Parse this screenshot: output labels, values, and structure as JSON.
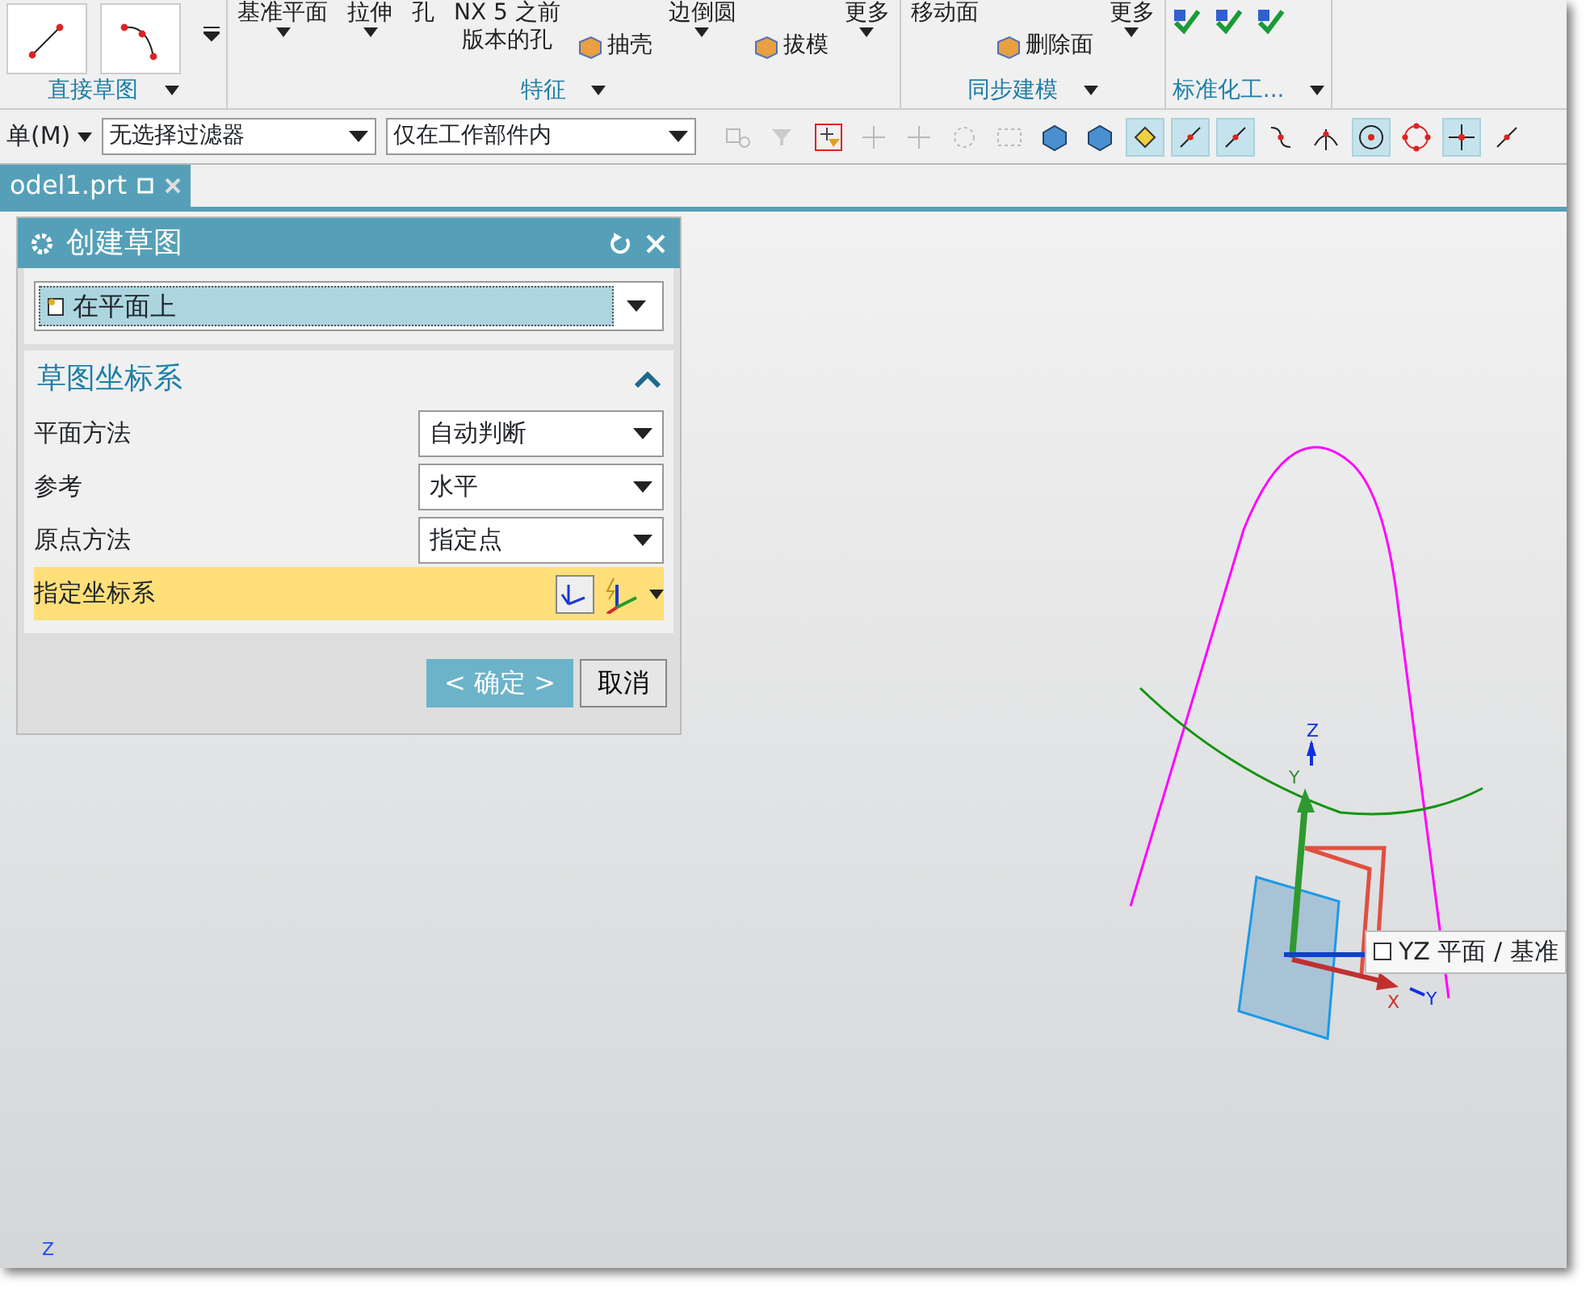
{
  "ribbon": {
    "groups": [
      {
        "label": "直接草图",
        "items": [
          {
            "kind": "line"
          },
          {
            "kind": "arc"
          }
        ]
      },
      {
        "label": "特征",
        "items": [
          {
            "kind": "large",
            "label": "基准平面",
            "dropdown": true
          },
          {
            "kind": "large",
            "label": "拉伸",
            "dropdown": true
          },
          {
            "kind": "large",
            "label": "孔",
            "dropdown": false
          },
          {
            "kind": "large",
            "label": "NX 5 之前",
            "label2": "版本的孔",
            "dropdown": false
          },
          {
            "kind": "small",
            "label": "抽壳"
          },
          {
            "kind": "large",
            "label": "边倒圆",
            "dropdown": true
          },
          {
            "kind": "small",
            "label": "拔模"
          },
          {
            "kind": "large",
            "label": "更多",
            "dropdown": true
          }
        ]
      },
      {
        "label": "同步建模",
        "items": [
          {
            "kind": "large",
            "label": "移动面",
            "dropdown": false
          },
          {
            "kind": "small",
            "label": "删除面"
          },
          {
            "kind": "large",
            "label": "更多",
            "dropdown": true
          }
        ]
      },
      {
        "label": "标准化工...",
        "items": [
          {
            "kind": "check"
          },
          {
            "kind": "check"
          },
          {
            "kind": "check"
          }
        ]
      }
    ]
  },
  "toolbar": {
    "menu": "单(M)",
    "filter": "无选择过滤器",
    "scope": "仅在工作部件内",
    "icons": [
      {
        "kind": "assembly",
        "disabled": true,
        "selected": false
      },
      {
        "kind": "funnel",
        "disabled": true,
        "selected": false
      },
      {
        "kind": "filter",
        "disabled": false,
        "selected": false
      },
      {
        "kind": "crosshair",
        "disabled": true,
        "selected": false
      },
      {
        "kind": "crosshair",
        "disabled": true,
        "selected": false
      },
      {
        "kind": "dotcircle",
        "disabled": true,
        "selected": false
      },
      {
        "kind": "rect",
        "disabled": true,
        "selected": false
      },
      {
        "kind": "cube",
        "disabled": false,
        "selected": false
      },
      {
        "kind": "cube",
        "disabled": false,
        "selected": false
      },
      {
        "kind": "point",
        "disabled": false,
        "selected": true
      },
      {
        "kind": "line",
        "disabled": false,
        "selected": true
      },
      {
        "kind": "line",
        "disabled": false,
        "selected": true
      },
      {
        "kind": "curve",
        "disabled": false,
        "selected": false
      },
      {
        "kind": "tangent",
        "disabled": false,
        "selected": false
      },
      {
        "kind": "circle",
        "disabled": false,
        "selected": true
      },
      {
        "kind": "ring",
        "disabled": false,
        "selected": false
      },
      {
        "kind": "plus",
        "disabled": false,
        "selected": true
      },
      {
        "kind": "line",
        "disabled": false,
        "selected": false
      }
    ]
  },
  "tabs": [
    {
      "label": "odel1.prt",
      "selected": true
    }
  ],
  "dialog": {
    "title": "创建草图",
    "type": "在平面上",
    "section": {
      "title": "草图坐标系",
      "expanded": true,
      "rows": [
        {
          "kind": "select",
          "label": "平面方法",
          "value": "自动判断"
        },
        {
          "kind": "select",
          "label": "参考",
          "value": "水平"
        },
        {
          "kind": "select",
          "label": "原点方法",
          "value": "指定点"
        },
        {
          "kind": "csys",
          "label": "指定坐标系",
          "highlighted": true
        }
      ]
    },
    "buttons": [
      {
        "label": "< 确定 >",
        "primary": true
      },
      {
        "label": "取消",
        "primary": false
      }
    ]
  },
  "viewport": {
    "triad_labels": [
      "Z",
      "Y",
      "X",
      "Y"
    ],
    "tooltip": "YZ 平面 / 基准",
    "corner_axis_label": "Z"
  }
}
